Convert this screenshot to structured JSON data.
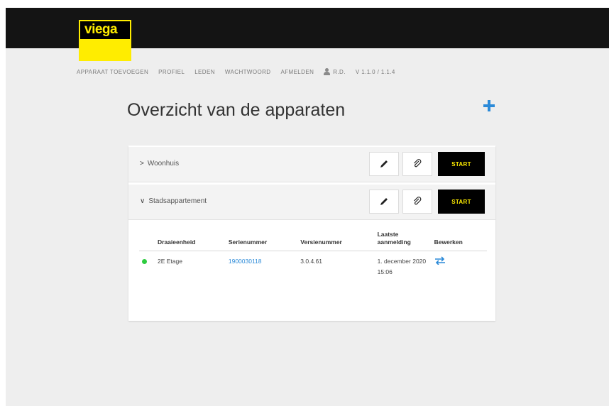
{
  "header": {
    "logo_text": "viega",
    "brand_color": "#ffed00"
  },
  "nav": {
    "items": [
      "APPARAAT TOEVOEGEN",
      "PROFIEL",
      "LEDEN",
      "WACHTWOORD",
      "AFMELDEN"
    ],
    "user_icon": "user-icon",
    "user_initials": "R.D.",
    "version": "V 1.1.0 / 1.1.4"
  },
  "main": {
    "title": "Overzicht van de apparaten",
    "add_icon": "plus-icon",
    "accent_color": "#2b8ad8"
  },
  "devices": [
    {
      "name": "Woonhuis",
      "expanded": false,
      "edit_icon": "pencil-icon",
      "link_icon": "paperclip-icon",
      "start_label": "START"
    },
    {
      "name": "Stadsappartement",
      "expanded": true,
      "edit_icon": "pencil-icon",
      "link_icon": "paperclip-icon",
      "start_label": "START"
    }
  ],
  "table": {
    "columns": [
      "Draaieenheid",
      "Serienummer",
      "Versienummer",
      "Laatste aanmelding",
      "Bewerken"
    ],
    "rows": [
      {
        "status": "online",
        "status_color": "#2ecc40",
        "unit": "2E Etage",
        "serial": "1900030118",
        "version": "3.0.4.61",
        "last_login": "1. december 2020 15:06",
        "edit_icon": "swap-arrows-icon"
      }
    ]
  }
}
